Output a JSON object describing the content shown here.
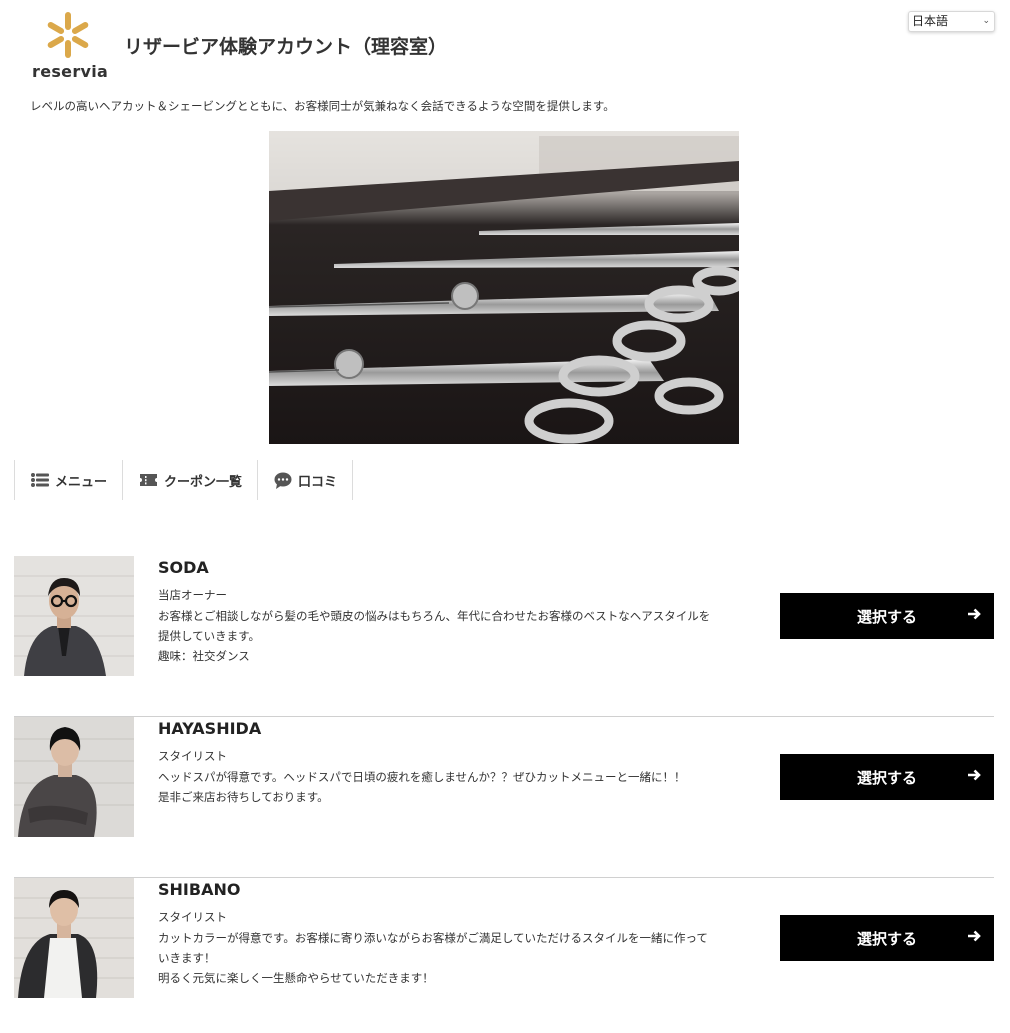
{
  "language": {
    "selected": "日本語"
  },
  "brand": {
    "logo_text": "reservia",
    "accent": "#dba84a"
  },
  "shop": {
    "title": "リザービア体験アカウント（理容室）",
    "description": "レベルの高いヘアカット＆シェービングとともに、お客様同士が気兼ねなく会話できるような空間を提供します。"
  },
  "tabs": [
    {
      "label": "メニュー",
      "icon": "list-icon"
    },
    {
      "label": "クーポン一覧",
      "icon": "ticket-icon"
    },
    {
      "label": "口コミ",
      "icon": "comment-icon"
    }
  ],
  "staff": [
    {
      "name": "SODA",
      "role": "当店オーナー",
      "bio": [
        "お客様とご相談しながら髪の毛や頭皮の悩みはもちろん、年代に合わせたお客様のベストなヘアスタイルを",
        "提供していきます。",
        "趣味：社交ダンス"
      ],
      "button": "選択する"
    },
    {
      "name": "HAYASHIDA",
      "role": "スタイリスト",
      "bio": [
        "ヘッドスパが得意です。ヘッドスパで日頃の疲れを癒しませんか？？ぜひカットメニューと一緒に！！",
        "是非ご来店お待ちしております。"
      ],
      "button": "選択する"
    },
    {
      "name": "SHIBANO",
      "role": "スタイリスト",
      "bio": [
        "カットカラーが得意です。お客様に寄り添いながらお客様がご満足していただけるスタイルを一緒に作って",
        "いきます！",
        "明るく元気に楽しく一生懸命やらせていただきます！"
      ],
      "button": "選択する"
    }
  ]
}
